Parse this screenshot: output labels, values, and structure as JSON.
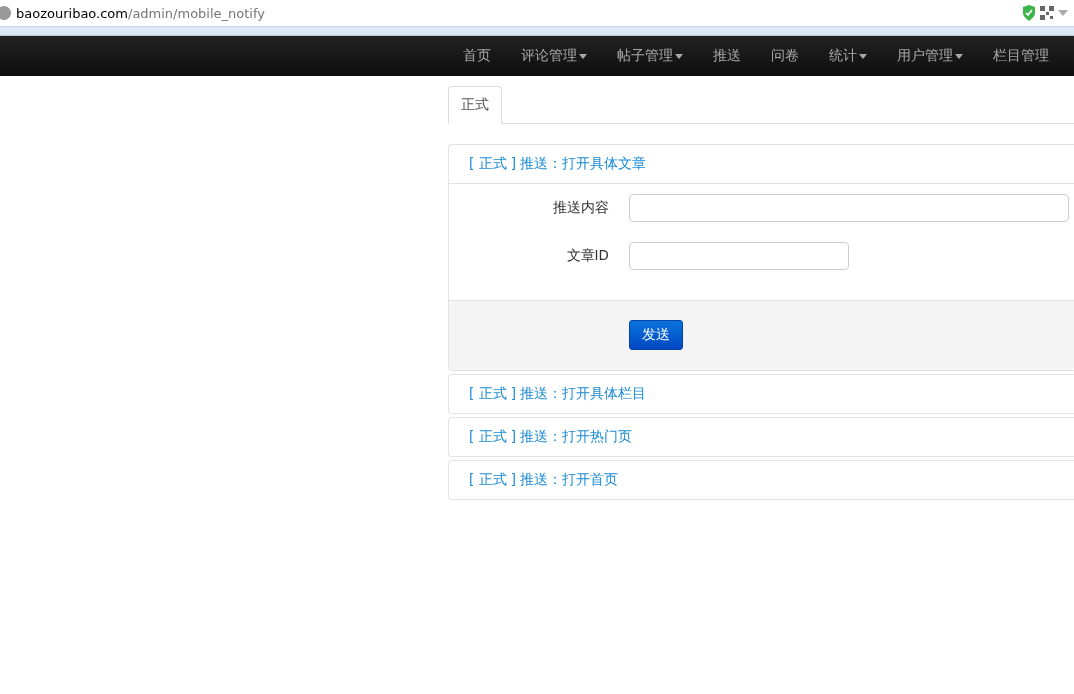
{
  "address_bar": {
    "domain": "baozouribao.com",
    "path": "/admin/mobile_notify"
  },
  "navbar": {
    "items": [
      {
        "label": "首页",
        "dropdown": false
      },
      {
        "label": "评论管理",
        "dropdown": true
      },
      {
        "label": "帖子管理",
        "dropdown": true
      },
      {
        "label": "推送",
        "dropdown": false
      },
      {
        "label": "问卷",
        "dropdown": false
      },
      {
        "label": "统计",
        "dropdown": true
      },
      {
        "label": "用户管理",
        "dropdown": true
      },
      {
        "label": "栏目管理",
        "dropdown": false
      }
    ]
  },
  "tabs": [
    {
      "label": "正式",
      "selected": true
    }
  ],
  "panels": [
    {
      "title": "[ 正式 ] 推送：打开具体文章",
      "expanded": true,
      "fields": [
        {
          "label": "推送内容",
          "kind": "wide"
        },
        {
          "label": "文章ID",
          "kind": "short"
        }
      ],
      "button": "发送"
    },
    {
      "title": "[ 正式 ] 推送：打开具体栏目",
      "expanded": false
    },
    {
      "title": "[ 正式 ] 推送：打开热门页",
      "expanded": false
    },
    {
      "title": "[ 正式 ] 推送：打开首页",
      "expanded": false
    }
  ]
}
